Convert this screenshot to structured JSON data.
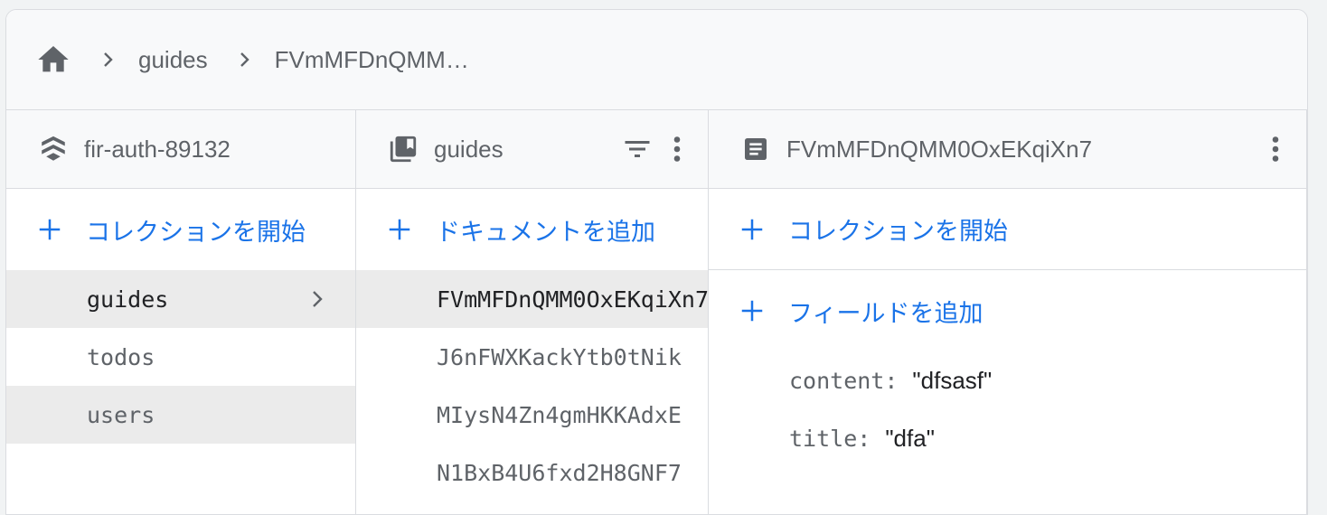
{
  "breadcrumb": {
    "home_icon": "home-icon",
    "items": [
      "guides",
      "FVmMFDnQMM…"
    ]
  },
  "project_column": {
    "title": "fir-auth-89132",
    "icon": "firestore-icon",
    "add_label": "コレクションを開始",
    "collections": [
      "guides",
      "todos",
      "users"
    ]
  },
  "collection_column": {
    "title": "guides",
    "icon": "collection-icon",
    "add_label": "ドキュメントを追加",
    "documents": [
      "FVmMFDnQMM0OxEKqiXn7",
      "J6nFWXKackYtb0tNik",
      "MIysN4Zn4gmHKKAdxE",
      "N1BxB4U6fxd2H8GNF7"
    ]
  },
  "document_column": {
    "title": "FVmMFDnQMM0OxEKqiXn7",
    "icon": "document-icon",
    "add_collection_label": "コレクションを開始",
    "add_field_label": "フィールドを追加",
    "fields": [
      {
        "key": "content",
        "value": "\"dfsasf\""
      },
      {
        "key": "title",
        "value": "\"dfa\""
      }
    ]
  },
  "colors": {
    "accent": "#1a73e8",
    "icon_gray": "#5f6368",
    "selected_bg": "#ebebeb"
  }
}
